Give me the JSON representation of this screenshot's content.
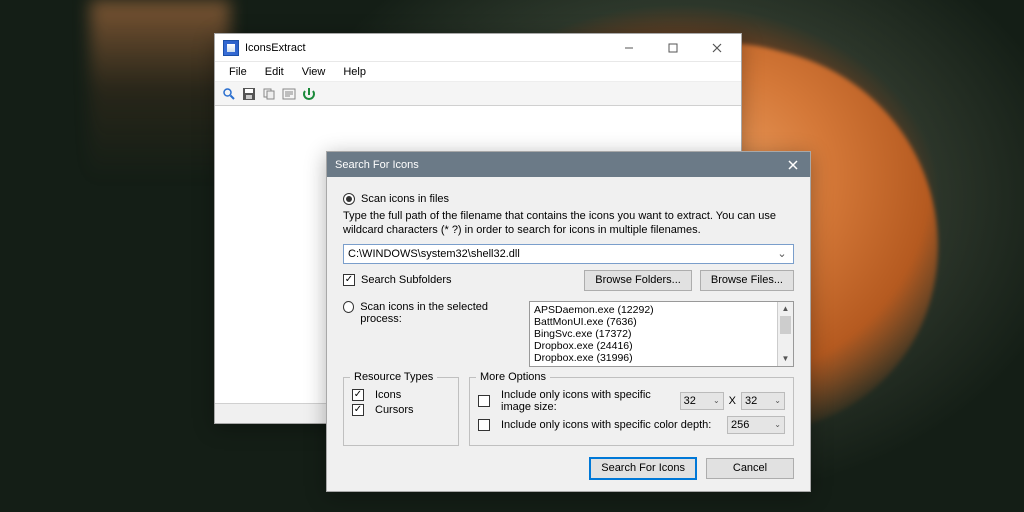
{
  "main": {
    "title": "IconsExtract",
    "menus": [
      "File",
      "Edit",
      "View",
      "Help"
    ]
  },
  "dialog": {
    "title": "Search For Icons",
    "scan_files_label": "Scan icons in files",
    "hint": "Type the full path of the filename that contains the icons you want to extract. You can use wildcard characters (* ?) in order to search for icons in multiple filenames.",
    "path_value": "C:\\WINDOWS\\system32\\shell32.dll",
    "search_subfolders": "Search Subfolders",
    "browse_folders": "Browse Folders...",
    "browse_files": "Browse Files...",
    "scan_process_label": "Scan icons in the selected process:",
    "processes": [
      "APSDaemon.exe  (12292)",
      "BattMonUI.exe  (7636)",
      "BingSvc.exe  (17372)",
      "Dropbox.exe  (24416)",
      "Dropbox.exe  (31996)"
    ],
    "group_res": "Resource Types",
    "res_icons": "Icons",
    "res_cursors": "Cursors",
    "group_more": "More Options",
    "more_size": "Include only icons with specific image size:",
    "more_depth": "Include only icons with specific color depth:",
    "size_w": "32",
    "size_h": "32",
    "size_x": "X",
    "depth": "256",
    "action_search": "Search For Icons",
    "action_cancel": "Cancel"
  }
}
